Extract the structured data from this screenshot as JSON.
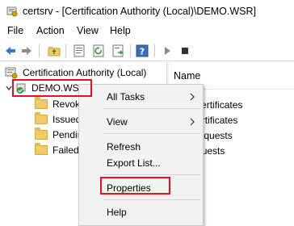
{
  "window": {
    "title": "certsrv - [Certification Authority (Local)\\DEMO.WSR]"
  },
  "menubar": {
    "items": [
      "File",
      "Action",
      "View",
      "Help"
    ]
  },
  "toolbar": {
    "icons": [
      "back-icon",
      "forward-icon",
      "up-folder-icon",
      "properties-sheet-icon",
      "refresh-icon",
      "export-list-icon",
      "help-icon",
      "start-service-icon",
      "stop-service-icon"
    ]
  },
  "tree": {
    "root": "Certification Authority (Local)",
    "ca": "DEMO.WSR",
    "children": [
      "Revok",
      "Issued",
      "Pendin",
      "Failed"
    ]
  },
  "rightpane": {
    "column": "Name",
    "items": [
      "Revoked Certificates",
      "Issued Certificates",
      "Pending Requests",
      "Failed Requests"
    ],
    "visible_items": [
      "oked Certificates",
      "ued Certificates",
      "ding Requests",
      "ed Requests"
    ]
  },
  "context_menu": {
    "all_tasks": "All Tasks",
    "view": "View",
    "refresh": "Refresh",
    "export_list": "Export List...",
    "properties": "Properties",
    "help": "Help"
  },
  "colors": {
    "highlight": "#e8111f",
    "folder": "#f1cb63",
    "menu_bg": "#f2f2f2"
  }
}
